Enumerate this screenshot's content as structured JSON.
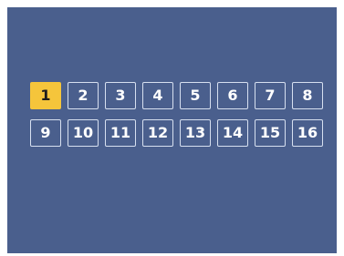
{
  "pager": {
    "pages": [
      "1",
      "2",
      "3",
      "4",
      "5",
      "6",
      "7",
      "8",
      "9",
      "10",
      "11",
      "12",
      "13",
      "14",
      "15",
      "16"
    ],
    "selected_index": 0
  },
  "colors": {
    "background": "#4a5f8d",
    "cell_border": "#d7e0f0",
    "selected_fill": "#f5c53b"
  }
}
